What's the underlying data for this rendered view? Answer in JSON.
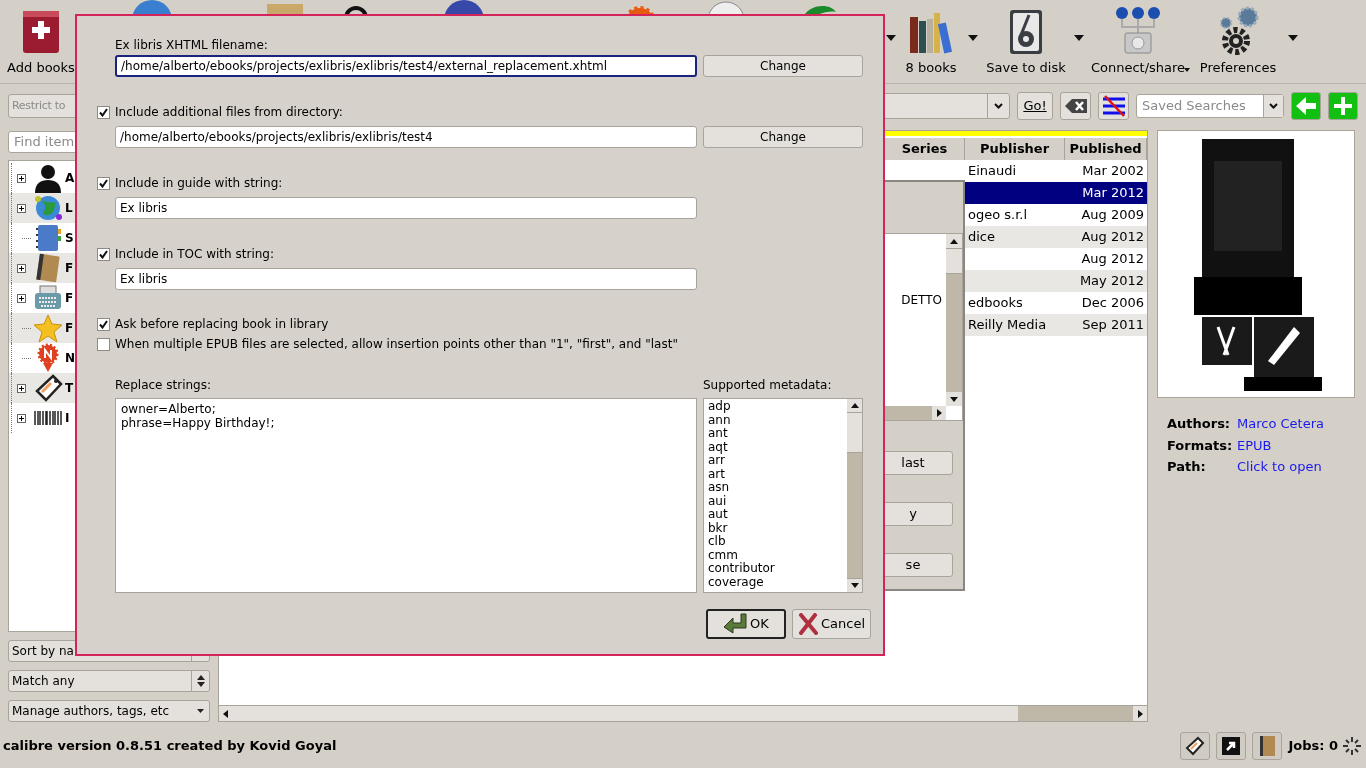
{
  "toolbar": {
    "buttons": [
      {
        "label": "Add books",
        "menu": false
      },
      {
        "label": "8 books",
        "menu": true,
        "menu_below": false
      },
      {
        "label": "Save to disk",
        "menu": true,
        "menu_below": false
      },
      {
        "label": "Connect/share",
        "menu": true,
        "menu_below": true
      },
      {
        "label": "Preferences",
        "menu": true,
        "menu_below": false
      }
    ]
  },
  "search_bar": {
    "restrict": {
      "placeholder": "Restrict to"
    },
    "go_button": "Go!",
    "saved_searches": {
      "placeholder": "Saved Searches"
    }
  },
  "tag_browser": {
    "find": {
      "placeholder": "Find item"
    },
    "items": [
      {
        "label": "A",
        "expandable": true
      },
      {
        "label": "L",
        "expandable": true
      },
      {
        "label": "S",
        "expandable": false
      },
      {
        "label": "F",
        "expandable": true
      },
      {
        "label": "F",
        "expandable": true
      },
      {
        "label": "F",
        "expandable": false
      },
      {
        "label": "N",
        "expandable": false
      },
      {
        "label": "T",
        "expandable": true
      },
      {
        "label": "I",
        "expandable": true
      }
    ],
    "sort": "Sort by na",
    "match": "Match any",
    "manage": "Manage authors, tags, etc"
  },
  "book_list": {
    "columns": [
      "Series",
      "Publisher",
      "Published"
    ],
    "rows": [
      {
        "publisher": "Einaudi",
        "published": "Mar 2002",
        "selected": false
      },
      {
        "published": "Mar 2012",
        "selected": true
      },
      {
        "publisher": "ogeo s.r.l",
        "published": "Aug 2009",
        "selected": false
      },
      {
        "publisher": "dice",
        "published": "Aug 2012",
        "selected": false
      },
      {
        "published": "Aug 2012",
        "selected": false
      },
      {
        "published": "May 2012",
        "selected": false
      },
      {
        "publisher": "edbooks",
        "published": "Dec 2006",
        "selected": false
      },
      {
        "publisher": "Reilly Media",
        "published": "Sep 2011",
        "selected": false
      }
    ]
  },
  "book_details": {
    "fields": [
      {
        "label": "Authors:",
        "value": "Marco Cetera"
      },
      {
        "label": "Formats:",
        "value": "EPUB"
      },
      {
        "label": "Path:",
        "value": "Click to open"
      }
    ]
  },
  "background_dialog": {
    "list_text": "DETTO",
    "buttons": [
      "last",
      "y",
      "se"
    ]
  },
  "dialog": {
    "filename": {
      "label": "Ex libris XHTML filename:",
      "value": "/home/alberto/ebooks/projects/exlibris/exlibris/test4/external_replacement.xhtml",
      "button": "Change"
    },
    "options": [
      {
        "kind": "path",
        "label": "Include additional files from directory:",
        "checked": true,
        "value": "/home/alberto/ebooks/projects/exlibris/exlibris/test4",
        "button": "Change"
      },
      {
        "kind": "string",
        "label": "Include in guide with string:",
        "checked": true,
        "value": "Ex libris"
      },
      {
        "kind": "string",
        "label": "Include in TOC with string:",
        "checked": true,
        "value": "Ex libris"
      }
    ],
    "flags": [
      {
        "label": "Ask before replacing book in library",
        "checked": true
      },
      {
        "label": "When multiple EPUB files are selected, allow insertion points other than \"1\", \"first\", and \"last\"",
        "checked": false
      }
    ],
    "replace_strings": {
      "label": "Replace strings:",
      "lines": [
        "owner=Alberto;",
        "phrase=Happy Birthday!;"
      ]
    },
    "supported_metadata": {
      "label": "Supported metadata:",
      "items": [
        "adp",
        "ann",
        "ant",
        "aqt",
        "arr",
        "art",
        "asn",
        "aui",
        "aut",
        "bkr",
        "clb",
        "cmm",
        "contributor",
        "coverage"
      ]
    },
    "buttons": [
      {
        "label": "OK",
        "kind": "ok",
        "default": true
      },
      {
        "label": "Cancel",
        "kind": "cancel",
        "default": false
      }
    ]
  },
  "status_bar": {
    "text": "calibre version 0.8.51 created by Kovid Goyal",
    "jobs": "Jobs: 0"
  }
}
